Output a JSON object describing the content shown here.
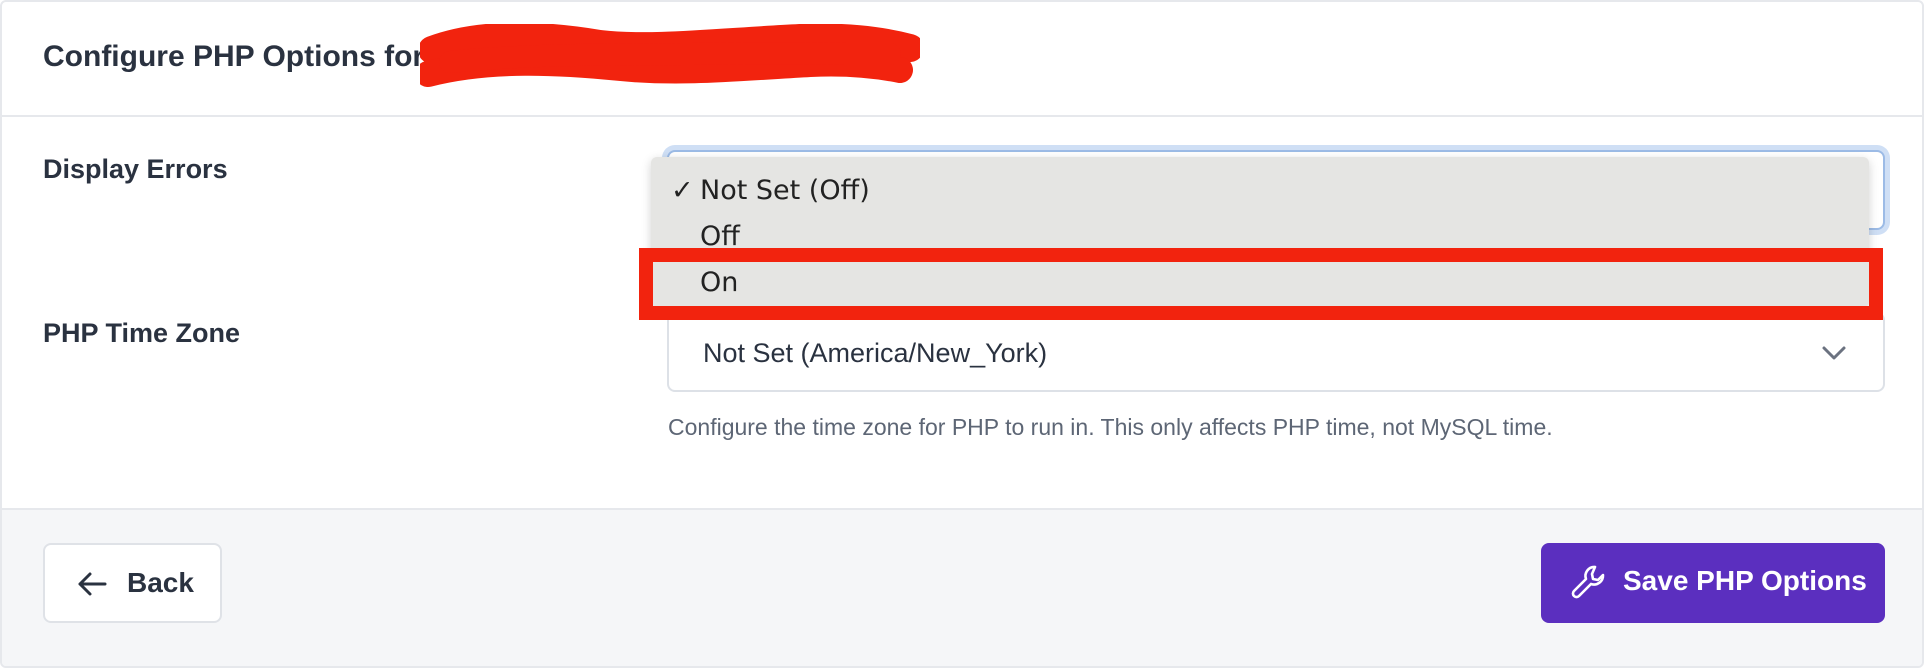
{
  "header": {
    "title": "Configure PHP Options for"
  },
  "display_errors": {
    "label": "Display Errors",
    "dropdown": {
      "selected_marker": "✓",
      "options": [
        {
          "label": "Not Set (Off)",
          "selected": true
        },
        {
          "label": "Off",
          "selected": false
        },
        {
          "label": "On",
          "selected": false,
          "highlighted": true
        }
      ]
    }
  },
  "time_zone": {
    "label": "PHP Time Zone",
    "value": "Not Set (America/New_York)",
    "help": "Configure the time zone for PHP to run in. This only affects PHP time, not MySQL time."
  },
  "footer": {
    "back_label": "Back",
    "save_label": "Save PHP Options"
  },
  "colors": {
    "primary_button": "#5b2fbf",
    "annotation_red": "#f2230e",
    "focus_ring": "#cfdff5"
  },
  "icons": {
    "back": "arrow-left-icon",
    "save": "wrench-icon",
    "select": "chevron-down-icon"
  }
}
